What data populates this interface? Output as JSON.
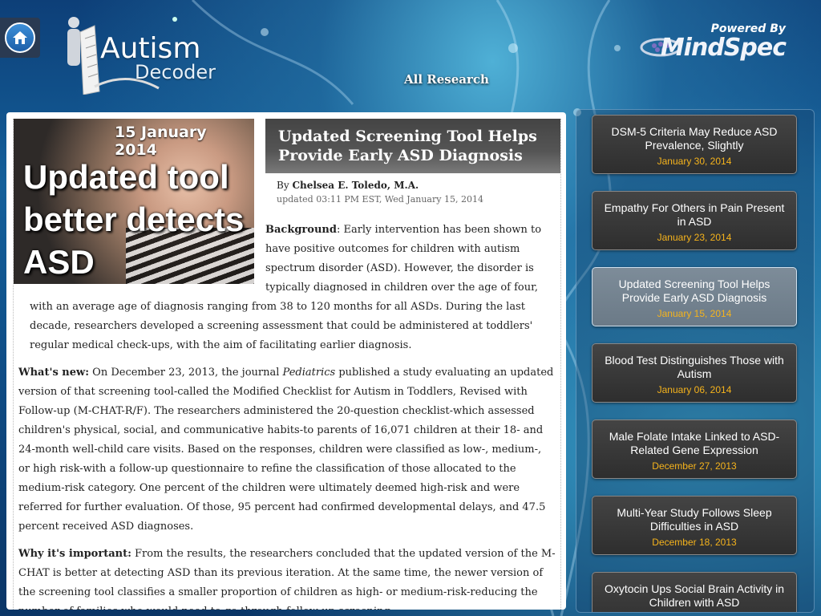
{
  "header": {
    "app_title_line1": "Autism",
    "app_title_line2": "Decoder",
    "powered_by": "Powered By",
    "brand": "MindSpec",
    "section_title": "All Research"
  },
  "article": {
    "hero_date": "15 January 2014",
    "hero_headline": "Updated tool better detects ASD",
    "title": "Updated Screening Tool Helps Provide Early ASD Diagnosis",
    "by_prefix": "By",
    "author": "Chelsea E. Toledo, M.A.",
    "updated": "updated 03:11 PM EST, Wed January 15, 2014",
    "background_label": "Background",
    "background_text": ": Early intervention has been shown to have positive outcomes for children with autism spectrum disorder (ASD). However, the disorder is typically diagnosed in children over the age of four, with an average age of diagnosis ranging from 38 to 120 months for all ASDs. During the last decade, researchers developed a screening assessment that could be administered at toddlers' regular medical check-ups, with the aim of facilitating earlier diagnosis.",
    "whats_new_label": "What's new:",
    "whats_new_text_a": " On December 23, 2013, the journal ",
    "journal": "Pediatrics",
    "whats_new_text_b": " published a study evaluating an updated version of that screening tool-called the Modified Checklist for Autism in Toddlers, Revised with Follow-up (M-CHAT-R/F). The researchers administered the 20-question checklist-which assessed children's physical, social, and communicative habits-to parents of 16,071 children at their 18- and 24-month well-child care visits. Based on the responses, children were classified as low-, medium-, or high risk-with a follow-up questionnaire to refine the classification of those allocated to the medium-risk category. One percent of the children were ultimately deemed high-risk and were referred for further evaluation. Of those, 95 percent had confirmed developmental delays, and 47.5 percent received ASD diagnoses.",
    "why_label": "Why it's important:",
    "why_text": " From the results, the researchers concluded that the updated version of the M-CHAT is better at detecting ASD than its previous iteration. At the same time, the newer version of the screening tool classifies a smaller proportion of children as high- or medium-risk-reducing the number of families who would need to go through follow-up screening."
  },
  "sidebar": {
    "items": [
      {
        "title": "DSM-5 Criteria May Reduce ASD Prevalence, Slightly",
        "date": "January 30, 2014"
      },
      {
        "title": "Empathy For Others in Pain Present in ASD",
        "date": "January 23, 2014"
      },
      {
        "title": "Updated Screening Tool Helps Provide Early ASD Diagnosis",
        "date": "January 15, 2014"
      },
      {
        "title": "Blood Test Distinguishes Those with Autism",
        "date": "January 06, 2014"
      },
      {
        "title": "Male Folate Intake Linked to ASD-Related Gene Expression",
        "date": "December 27, 2013"
      },
      {
        "title": "Multi-Year Study Follows Sleep Difficulties in ASD",
        "date": "December 18, 2013"
      },
      {
        "title": "Oxytocin Ups Social Brain Activity in Children with ASD",
        "date": ""
      }
    ]
  },
  "colors": {
    "accent_date": "#f5b31c",
    "active_card": "#7d8c99"
  }
}
